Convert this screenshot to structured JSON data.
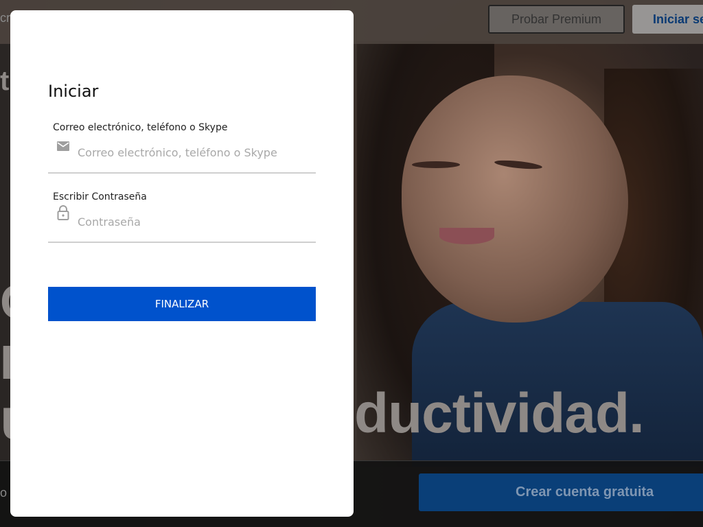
{
  "background": {
    "header": {
      "left_fragment": "cr",
      "premium_label": "Probar Premium",
      "login_label": "Iniciar se"
    },
    "hero": {
      "fragment_top": "tl",
      "fragment_c": "C",
      "fragment_i": "I",
      "fragment_u": "u",
      "visible_text": "ductividad."
    },
    "footer": {
      "left_fragment": "o",
      "create_account_label": "Crear cuenta gratuita"
    }
  },
  "login_modal": {
    "title": "Iniciar",
    "email_field": {
      "label": "Correo electrónico, teléfono o Skype",
      "placeholder": "Correo electrónico, teléfono o Skype",
      "value": "",
      "icon": "envelope-icon"
    },
    "password_field": {
      "label": "Escribir Contraseña",
      "placeholder": "Contraseña",
      "value": "",
      "icon": "lock-icon"
    },
    "submit_label": "FINALIZAR"
  },
  "colors": {
    "primary_button": "#0052cc",
    "background_overlay": "#2a2624"
  }
}
